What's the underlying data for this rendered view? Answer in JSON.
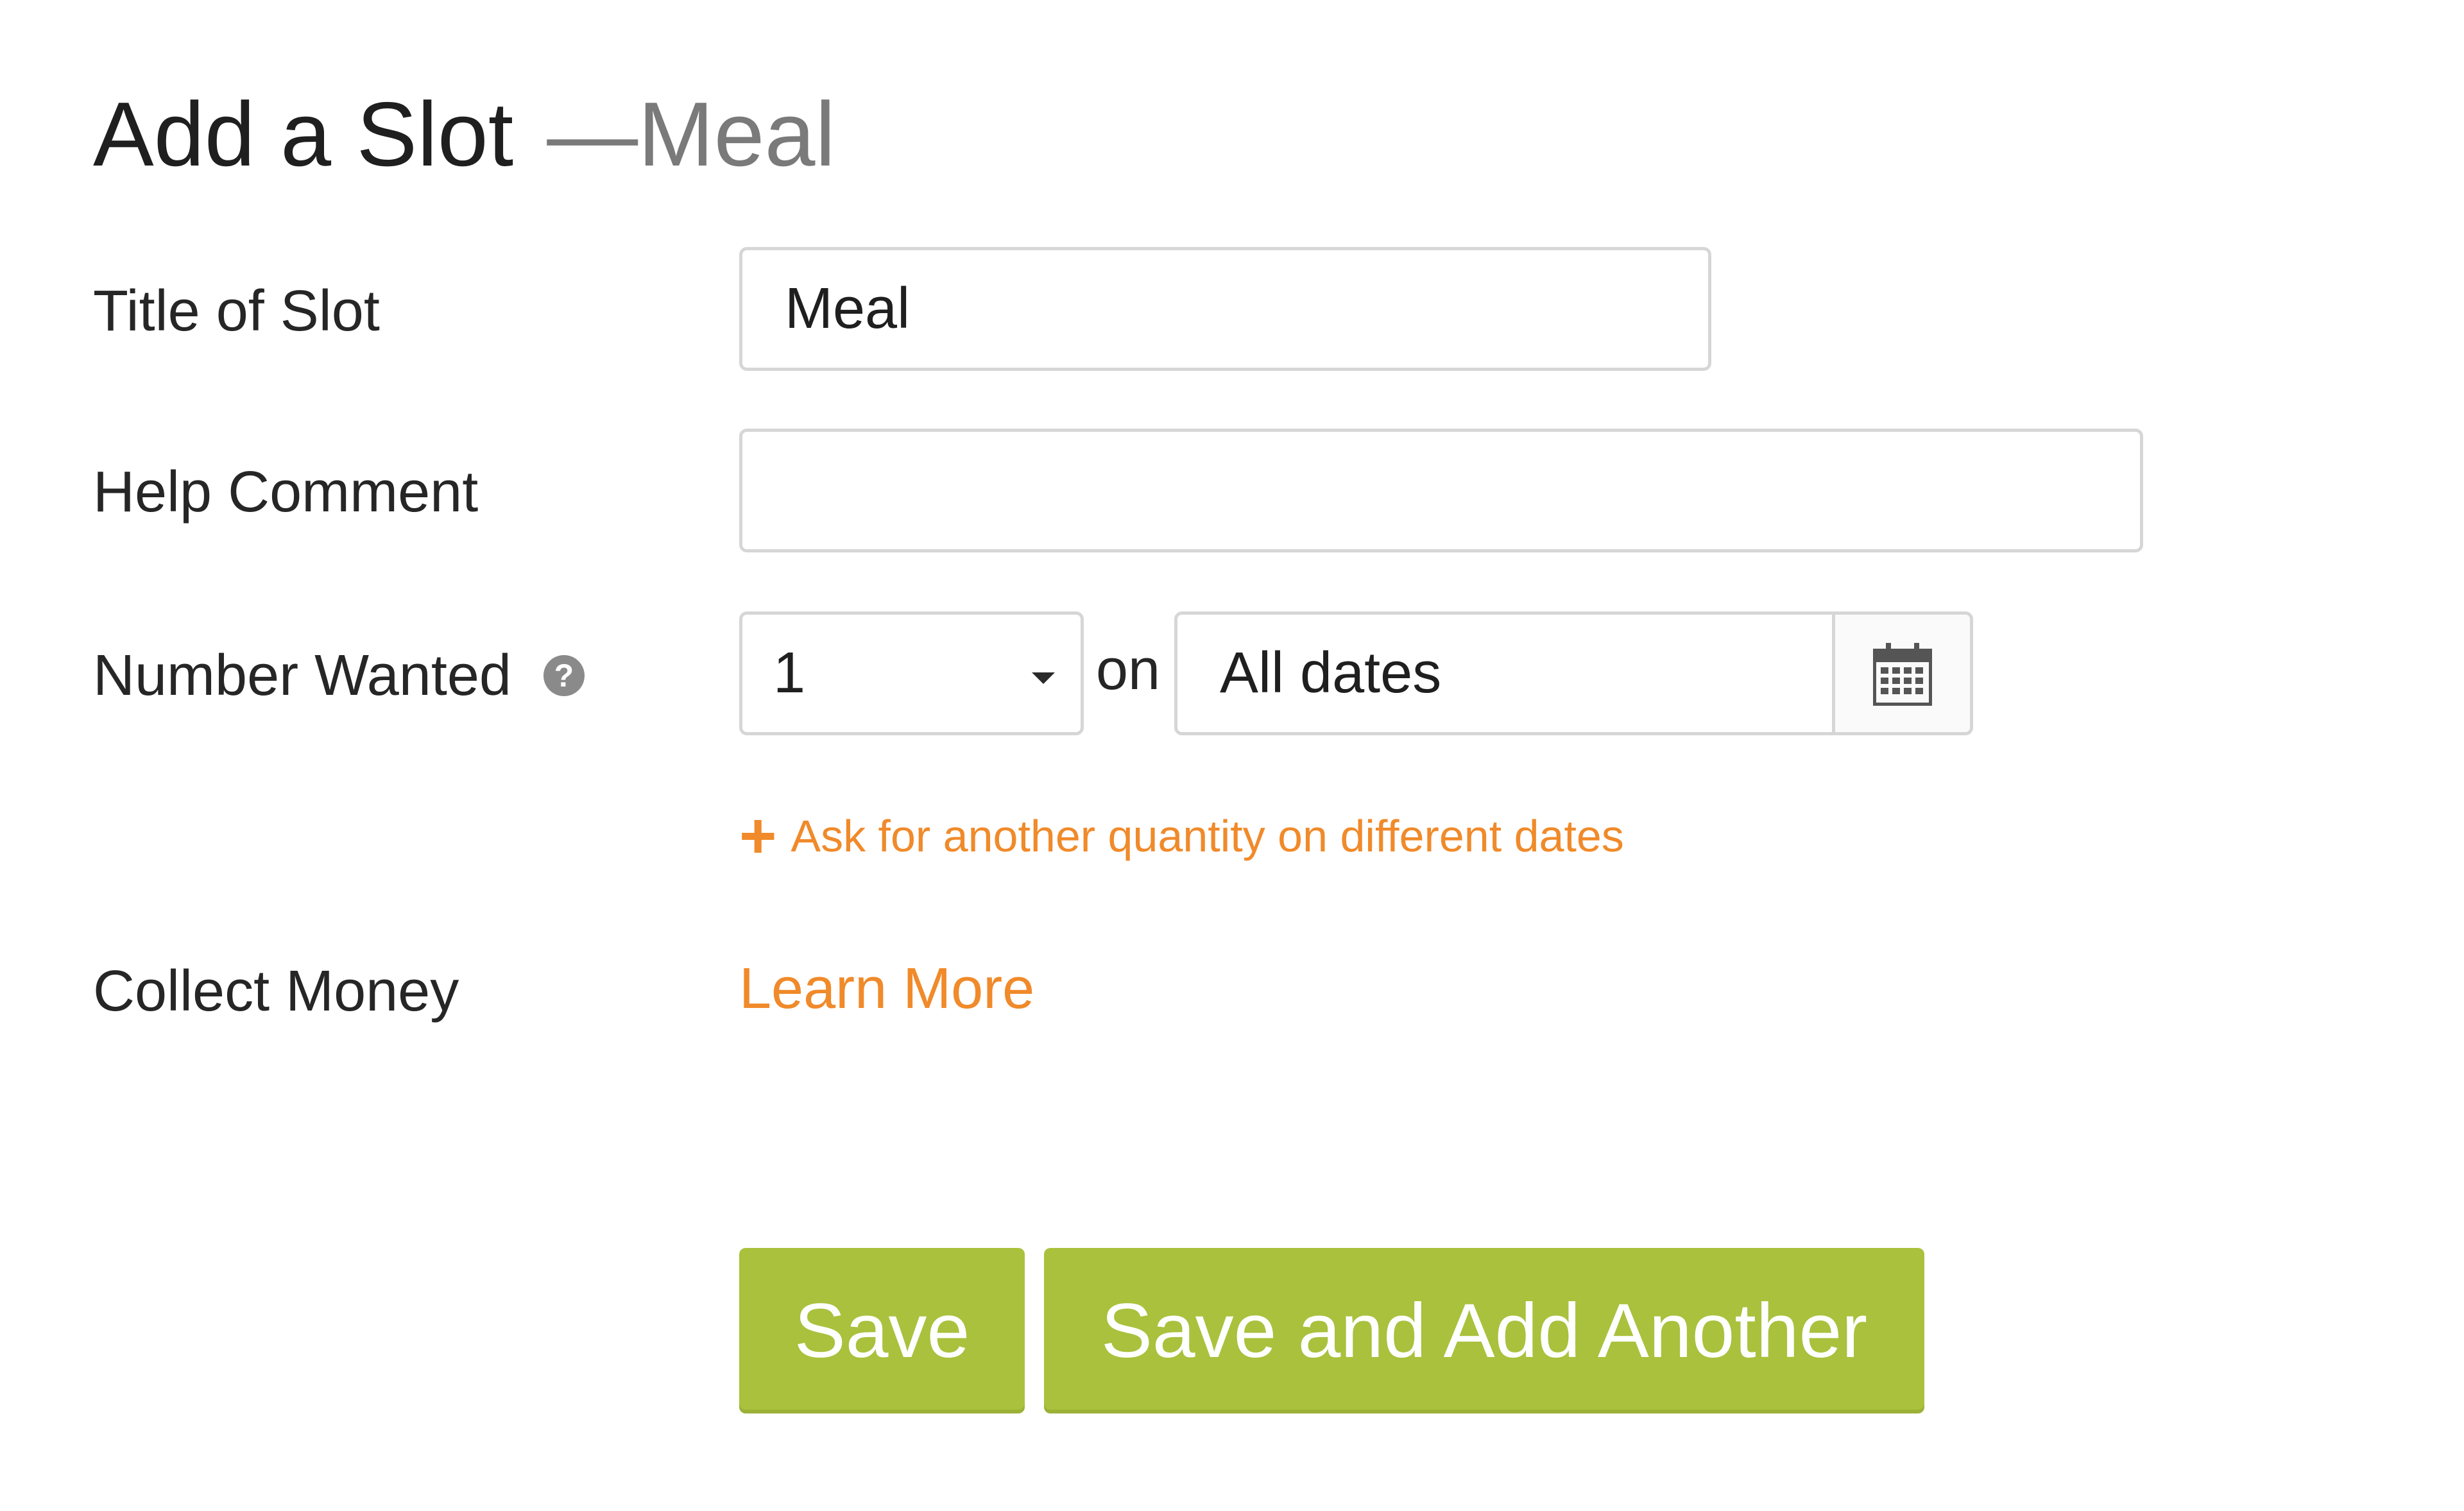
{
  "heading": {
    "title": "Add a Slot",
    "separator": "—",
    "subtitle": "Meal"
  },
  "form": {
    "title_label": "Title of Slot",
    "title_value": "Meal",
    "help_comment_label": "Help Comment",
    "help_comment_value": "",
    "number_wanted_label": "Number Wanted",
    "number_wanted_help_icon": "question-circle-icon",
    "number_wanted_value": "1",
    "on_text": "on",
    "dates_value": "All dates",
    "calendar_icon": "calendar-icon",
    "add_quantity_link": "Ask for another quantity on different dates",
    "collect_money_label": "Collect Money",
    "learn_more_link": "Learn More"
  },
  "buttons": {
    "save": "Save",
    "save_and_add": "Save and Add Another"
  },
  "colors": {
    "accent_orange": "#f08a2a",
    "button_green": "#a9c13c"
  }
}
